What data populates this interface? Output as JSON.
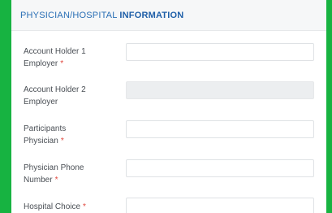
{
  "section": {
    "title_part1": "PHYSICIAN/HOSPITAL ",
    "title_part2": "INFORMATION"
  },
  "fields": [
    {
      "label_line1": "Account Holder 1",
      "label_line2": "Employer",
      "required": true,
      "value": "",
      "disabled": false
    },
    {
      "label_line1": "Account Holder 2",
      "label_line2": "Employer",
      "required": false,
      "value": "",
      "disabled": true
    },
    {
      "label_line1": "Participants",
      "label_line2": "Physician",
      "required": true,
      "value": "",
      "disabled": false
    },
    {
      "label_line1": "Physician Phone",
      "label_line2": "Number",
      "required": true,
      "value": "",
      "disabled": false
    },
    {
      "label_line1": "Hospital Choice",
      "label_line2": "",
      "required": true,
      "value": "",
      "disabled": false
    }
  ],
  "required_marker": "*",
  "colors": {
    "background": "#17b341",
    "title": "#2a6fb5",
    "required": "#e0463c"
  }
}
